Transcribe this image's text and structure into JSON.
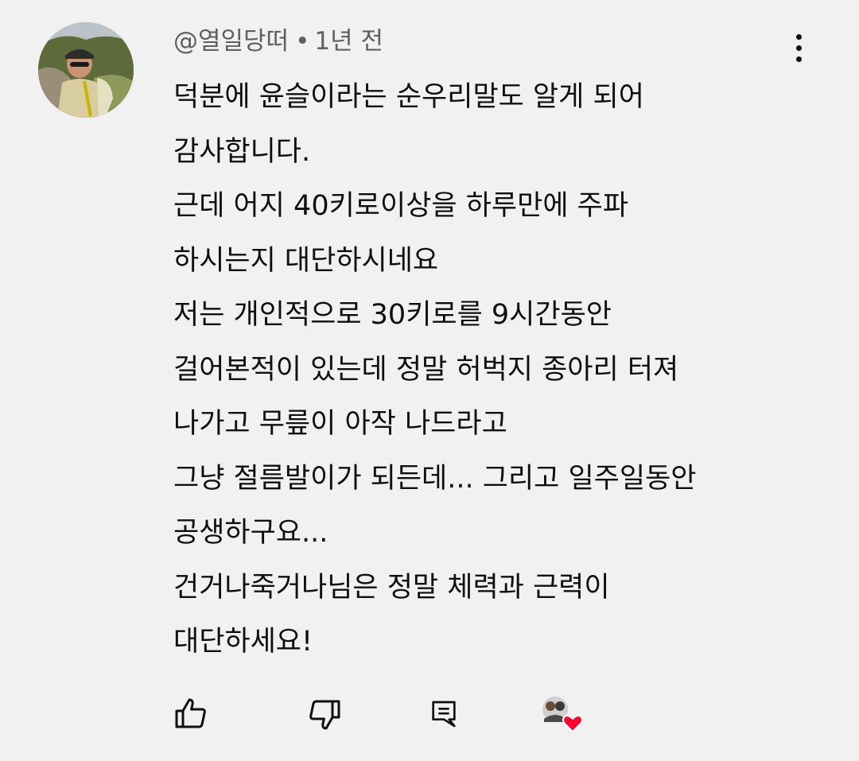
{
  "comment": {
    "author": "@열일당떠",
    "separator": "•",
    "time": "1년 전",
    "lines": [
      "덕분에 윤슬이라는 순우리말도 알게 되어",
      "감사합니다.",
      "근데 어지 40키로이상을 하루만에 주파",
      "하시는지 대단하시네요",
      "저는 개인적으로 30키로를 9시간동안",
      "걸어본적이 있는데 정말 허벅지 종아리 터져",
      "나가고 무릎이 아작 나드라고",
      "그냥 절름발이가 되든데... 그리고 일주일동안",
      "공생하구요...",
      "건거나죽거나님은 정말 체력과 근력이",
      "대단하세요!"
    ]
  },
  "actions": {
    "like_icon": "thumb-up-icon",
    "dislike_icon": "thumb-down-icon",
    "reply_icon": "comment-reply-icon",
    "hearted_icon": "creator-heart-icon"
  },
  "colors": {
    "background": "#f1f1f1",
    "text": "#0f0f0f",
    "meta": "#606060",
    "heart": "#ff0033"
  }
}
